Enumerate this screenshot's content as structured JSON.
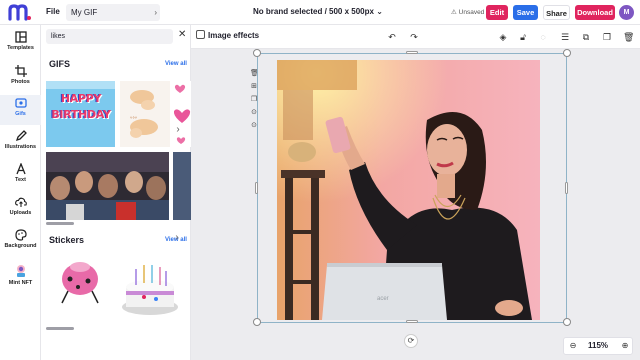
{
  "header": {
    "file_menu": "File",
    "doc_name": "My GIF",
    "brand_info": "No brand selected / 500 x 500px",
    "unsaved": "Unsaved",
    "edit_label": "Edit",
    "save_label": "Save",
    "share_label": "Share",
    "download_label": "Download",
    "avatar_initial": "M",
    "brand_color": "#e0245e",
    "save_color": "#2a6ee8"
  },
  "sidebar": {
    "items": [
      {
        "label": "Templates",
        "icon": "templates-icon"
      },
      {
        "label": "Photos",
        "icon": "crop-icon"
      },
      {
        "label": "Gifs",
        "icon": "gif-icon"
      },
      {
        "label": "Illustrations",
        "icon": "pen-icon"
      },
      {
        "label": "Text",
        "icon": "text-icon"
      },
      {
        "label": "Uploads",
        "icon": "upload-cloud-icon"
      },
      {
        "label": "Background",
        "icon": "palette-icon"
      },
      {
        "label": "Mint NFT",
        "icon": "nft-icon"
      }
    ],
    "active_index": 2
  },
  "panel": {
    "search_value": "likes",
    "gifs_title": "GIFS",
    "gifs_view_all": "View all",
    "stickers_title": "Stickers",
    "stickers_view_all": "View all",
    "birthday_text": "HAPPY BIRTHDAY"
  },
  "toolbar": {
    "image_effects": "Image effects"
  },
  "canvas": {
    "zoom": "115%"
  }
}
